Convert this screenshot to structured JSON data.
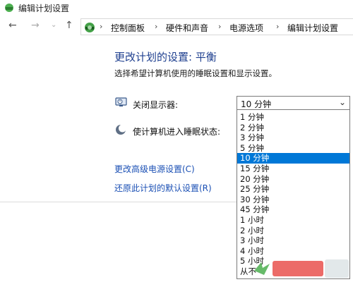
{
  "window": {
    "title": "编辑计划设置"
  },
  "nav": {
    "icons": [
      "arrow-left-icon",
      "arrow-right-icon",
      "chevron-down-icon",
      "arrow-up-icon"
    ],
    "breadcrumbs": [
      "控制面板",
      "硬件和声音",
      "电源选项",
      "编辑计划设置"
    ]
  },
  "main": {
    "heading": "更改计划的设置: 平衡",
    "subtitle": "选择希望计算机使用的睡眠设置和显示设置。",
    "display_label": "关闭显示器:",
    "sleep_label": "使计算机进入睡眠状态:"
  },
  "dropdown": {
    "selected_value": "10 分钟",
    "options": [
      "1 分钟",
      "2 分钟",
      "3 分钟",
      "5 分钟",
      "10 分钟",
      "15 分钟",
      "20 分钟",
      "25 分钟",
      "30 分钟",
      "45 分钟",
      "1 小时",
      "2 小时",
      "3 小时",
      "4 小时",
      "5 小时",
      "从不"
    ],
    "selected_index": 4
  },
  "links": {
    "advanced": "更改高级电源设置(C)",
    "restore": "还原此计划的默认设置(R)"
  },
  "colors": {
    "accent": "#0078d7",
    "heading": "#1e3f8f",
    "link": "#1a4fb4"
  }
}
